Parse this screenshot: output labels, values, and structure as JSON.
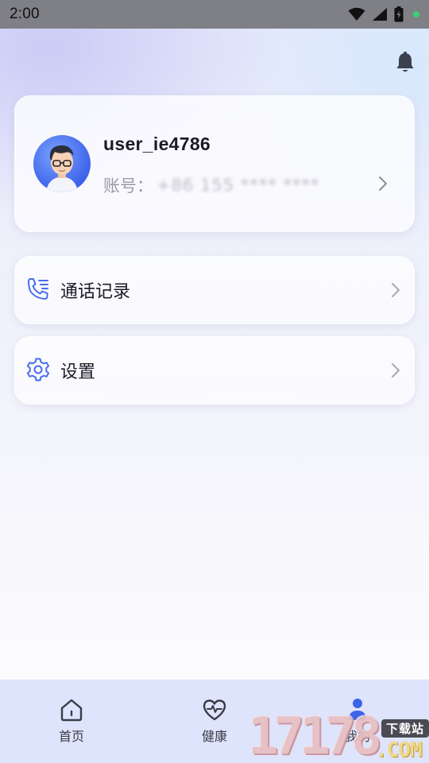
{
  "status_bar": {
    "time": "2:00",
    "icons": [
      "wifi-icon",
      "signal-icon",
      "battery-charging-icon",
      "notification-dot-icon"
    ]
  },
  "header": {
    "bell_icon": "bell-icon"
  },
  "profile": {
    "username": "user_ie4786",
    "account_label": "账号：",
    "account_value": "+86 155 **** ****",
    "chevron_icon": "chevron-right-icon"
  },
  "menu": [
    {
      "label": "通话记录",
      "icon": "phone-log-icon"
    },
    {
      "label": "设置",
      "icon": "gear-icon"
    }
  ],
  "bottom_nav": {
    "items": [
      {
        "label": "首页",
        "icon": "home-icon",
        "active": false
      },
      {
        "label": "健康",
        "icon": "heart-pulse-icon",
        "active": false
      },
      {
        "label": "我的",
        "icon": "person-icon",
        "active": true
      }
    ]
  },
  "watermark": {
    "digits": "17178",
    "tag": "下载站",
    "com": ".COM"
  },
  "colors": {
    "accent": "#3d63ea",
    "status_bar": "#7f7f86",
    "nav_bg": "#dde4fb",
    "icon_blue": "#4a6cf0"
  }
}
